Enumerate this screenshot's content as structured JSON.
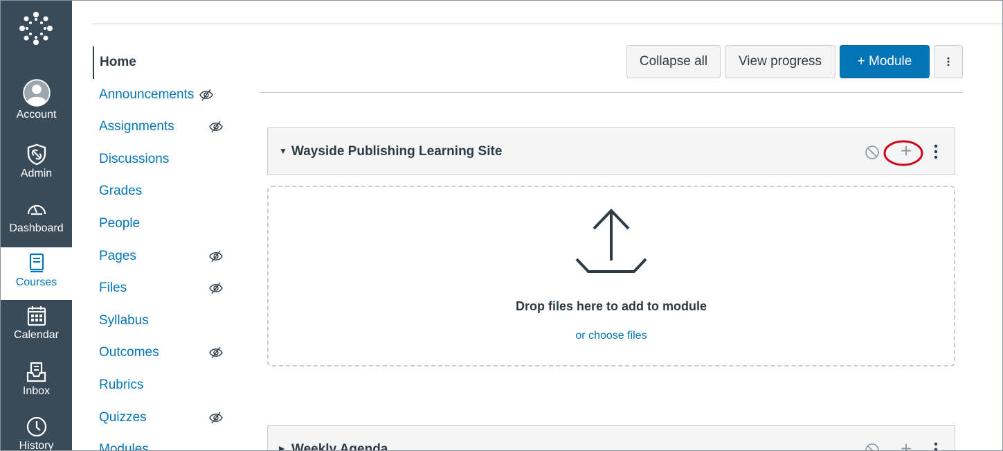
{
  "global_nav": {
    "account": "Account",
    "admin": "Admin",
    "dashboard": "Dashboard",
    "courses": "Courses",
    "calendar": "Calendar",
    "inbox": "Inbox",
    "history": "History"
  },
  "course_nav": {
    "items": [
      {
        "label": "Home",
        "active": true,
        "hidden": false
      },
      {
        "label": "Announcements",
        "hidden": true
      },
      {
        "label": "Assignments",
        "hidden": true
      },
      {
        "label": "Discussions",
        "hidden": false
      },
      {
        "label": "Grades",
        "hidden": false
      },
      {
        "label": "People",
        "hidden": false
      },
      {
        "label": "Pages",
        "hidden": true
      },
      {
        "label": "Files",
        "hidden": true
      },
      {
        "label": "Syllabus",
        "hidden": false
      },
      {
        "label": "Outcomes",
        "hidden": true
      },
      {
        "label": "Rubrics",
        "hidden": false
      },
      {
        "label": "Quizzes",
        "hidden": true
      },
      {
        "label": "Modules",
        "hidden": false
      }
    ]
  },
  "toolbar": {
    "collapse_all": "Collapse all",
    "view_progress": "View progress",
    "add_module": "+ Module"
  },
  "modules": [
    {
      "title": "Wayside Publishing Learning Site"
    },
    {
      "title": "Weekly Agenda"
    }
  ],
  "dropzone": {
    "title": "Drop files here to add to module",
    "choose": "or choose files"
  },
  "colors": {
    "nav_bg": "#394b58",
    "link": "#0374b5",
    "highlight": "#d0021b"
  }
}
